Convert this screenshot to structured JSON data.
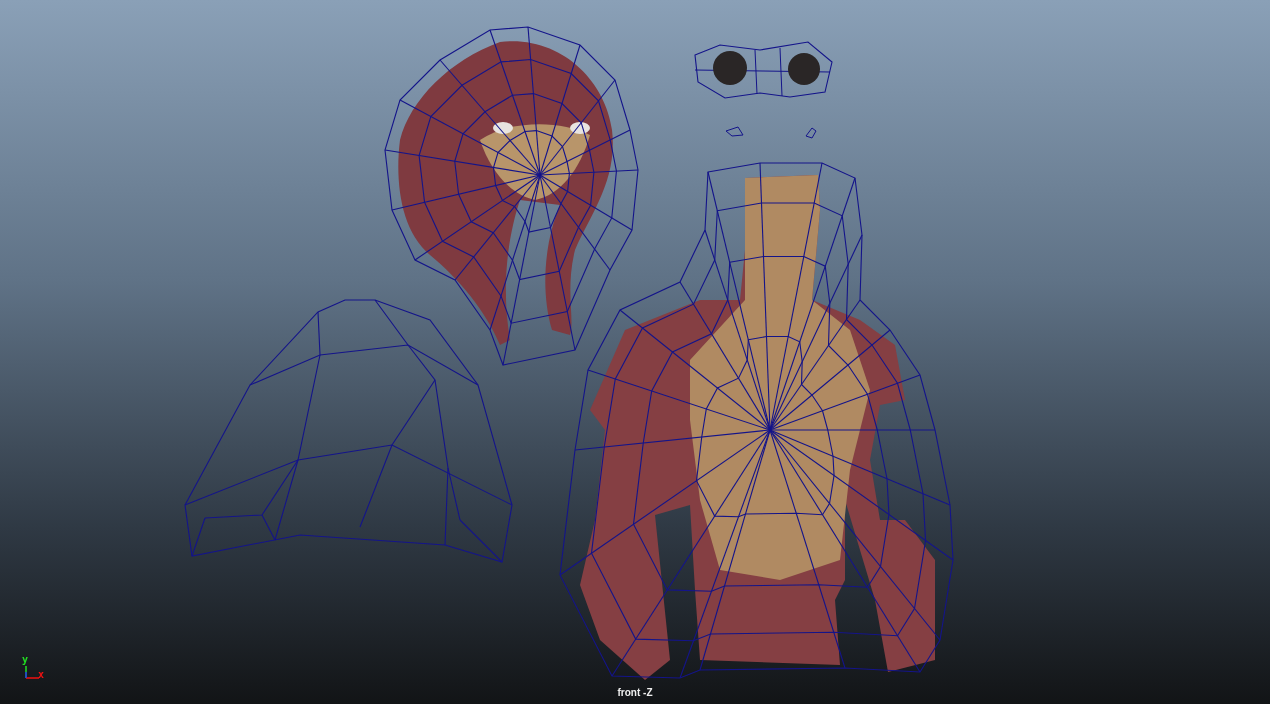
{
  "viewport": {
    "camera_label": "front -Z",
    "axis": {
      "x_label": "x",
      "y_label": "y"
    }
  }
}
